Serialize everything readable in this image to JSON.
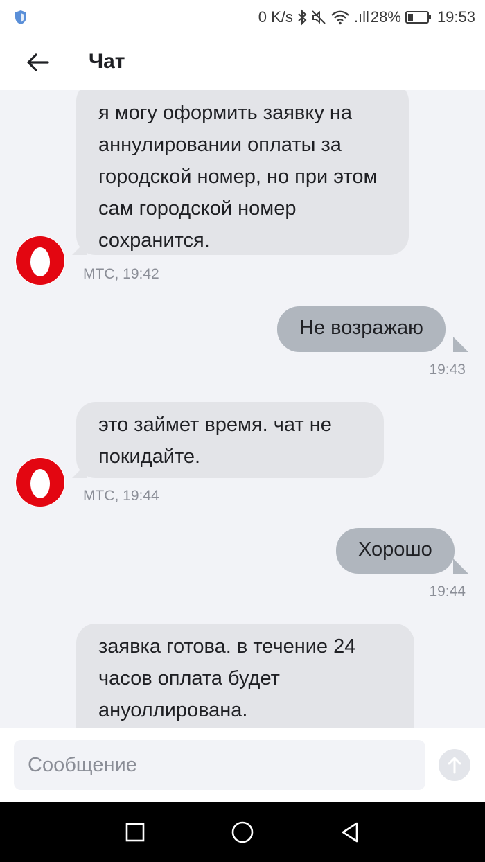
{
  "status_bar": {
    "speed": "0 K/s",
    "signal": ".ıll",
    "battery_percent": "28%",
    "battery_level": 0.28,
    "time": "19:53",
    "icons": [
      "shield-icon",
      "bluetooth-icon",
      "mute-icon",
      "wifi-icon",
      "signal-icon",
      "battery-icon"
    ]
  },
  "header": {
    "title": "Чат",
    "back_icon": "back-arrow-icon"
  },
  "messages": [
    {
      "direction": "in",
      "text": "я могу оформить заявку на аннулировании оплаты за городской номер, но при этом сам городской номер сохранится.",
      "meta": "МТС, 19:42"
    },
    {
      "direction": "out",
      "text": "Не возражаю",
      "meta": "19:43"
    },
    {
      "direction": "in",
      "text": "это займет время. чат не покидайте.",
      "meta": "МТС, 19:44"
    },
    {
      "direction": "out",
      "text": "Хорошо",
      "meta": "19:44"
    },
    {
      "direction": "in",
      "text": "заявка готова. в течение 24 часов оплата будет ануоллирована.",
      "meta": ""
    }
  ],
  "composer": {
    "placeholder": "Сообщение",
    "value": "",
    "send_icon": "send-arrow-icon"
  },
  "colors": {
    "incoming_bubble": "#e3e4e8",
    "outgoing_bubble": "#b0b6be",
    "chat_background": "#f2f3f7",
    "avatar_red": "#e30611"
  },
  "nav_bar": {
    "icons": [
      "recent-apps-icon",
      "home-icon",
      "back-icon"
    ]
  }
}
